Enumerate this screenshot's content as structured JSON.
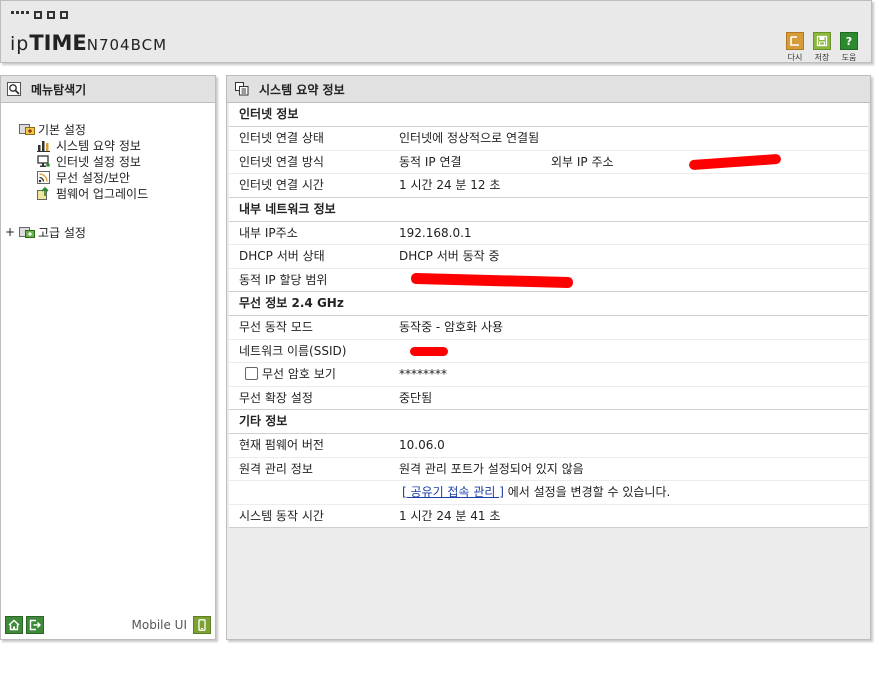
{
  "header": {
    "brand_ip": "ip",
    "brand_time": "TIME",
    "model": "N704BCM",
    "buttons": [
      {
        "icon": "undo-icon",
        "label": "다시"
      },
      {
        "icon": "save-icon",
        "label": "저장"
      },
      {
        "icon": "help-icon",
        "label": "도움",
        "glyph": "?"
      }
    ]
  },
  "sidebar": {
    "title": "메뉴탐색기",
    "groups": [
      {
        "label": "기본 설정",
        "items": [
          "시스템 요약 정보",
          "인터넷 설정 정보",
          "무선 설정/보안",
          "펌웨어 업그레이드"
        ]
      },
      {
        "label": "고급 설정",
        "prefix": "+"
      }
    ],
    "mobile_label": "Mobile UI"
  },
  "main": {
    "title": "시스템 요약 정보",
    "sections": [
      {
        "title": "인터넷 정보",
        "rows": [
          {
            "key": "인터넷 연결 상태",
            "value": "인터넷에 정상적으로 연결됨"
          },
          {
            "key": "인터넷 연결 방식",
            "value": "동적 IP 연결",
            "extra": "외부 IP 주소"
          },
          {
            "key": "인터넷 연결 시간",
            "value": "1 시간 24 분 12 초"
          }
        ]
      },
      {
        "title": "내부 네트워크 정보",
        "rows": [
          {
            "key": "내부 IP주소",
            "value": "192.168.0.1"
          },
          {
            "key": "DHCP 서버 상태",
            "value": "DHCP 서버 동작 중"
          },
          {
            "key": "동적 IP 할당 범위",
            "value": ""
          }
        ]
      },
      {
        "title": "무선 정보 2.4 GHz",
        "rows": [
          {
            "key": "무선 동작 모드",
            "value": "동작중 - 암호화 사용"
          },
          {
            "key": "네트워크 이름(SSID)",
            "value": ""
          },
          {
            "key": "무선 암호 보기",
            "value": "********"
          },
          {
            "key": "무선 확장 설정",
            "value": "중단됨"
          }
        ]
      },
      {
        "title": "기타 정보",
        "rows": [
          {
            "key": "현재 펌웨어 버전",
            "value": "10.06.0"
          },
          {
            "key": "원격 관리 정보",
            "value": "원격 관리 포트가 설정되어 있지 않음"
          },
          {
            "key": "",
            "link": "[ 공유기 접속 관리 ]",
            "value_after": " 에서 설정을 변경할 수 있습니다."
          },
          {
            "key": "시스템 동작 시간",
            "value": "1 시간 24 분 41 초"
          }
        ]
      }
    ]
  }
}
